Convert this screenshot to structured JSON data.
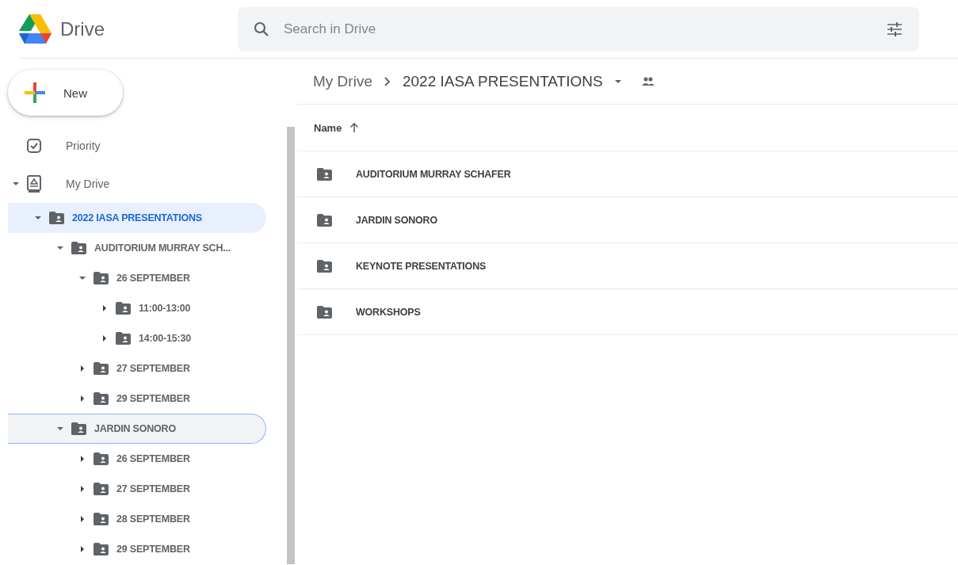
{
  "app": {
    "title": "Drive"
  },
  "search": {
    "placeholder": "Search in Drive"
  },
  "new_button": {
    "label": "New"
  },
  "sidebar": {
    "items": [
      {
        "label": "Priority",
        "kind": "priority",
        "selected": false,
        "focused": false
      },
      {
        "label": "My Drive",
        "kind": "drive",
        "expanded": true,
        "selected": false,
        "focused": false,
        "children": [
          {
            "label": "2022 IASA PRESENTATIONS",
            "kind": "folder",
            "expanded": true,
            "selected": true,
            "focused": false,
            "children": [
              {
                "label": "AUDITORIUM MURRAY SCH...",
                "kind": "folder",
                "expanded": true,
                "selected": false,
                "focused": false,
                "children": [
                  {
                    "label": "26 SEPTEMBER",
                    "kind": "folder",
                    "expanded": true,
                    "selected": false,
                    "focused": false,
                    "children": [
                      {
                        "label": "11:00-13:00",
                        "kind": "folder",
                        "expanded": false,
                        "selected": false,
                        "focused": false
                      },
                      {
                        "label": "14:00-15:30",
                        "kind": "folder",
                        "expanded": false,
                        "selected": false,
                        "focused": false
                      }
                    ]
                  },
                  {
                    "label": "27 SEPTEMBER",
                    "kind": "folder",
                    "expanded": false,
                    "selected": false,
                    "focused": false
                  },
                  {
                    "label": "29 SEPTEMBER",
                    "kind": "folder",
                    "expanded": false,
                    "selected": false,
                    "focused": false
                  }
                ]
              },
              {
                "label": "JARDIN SONORO",
                "kind": "folder",
                "expanded": true,
                "selected": false,
                "focused": true,
                "children": [
                  {
                    "label": "26 SEPTEMBER",
                    "kind": "folder",
                    "expanded": false,
                    "selected": false,
                    "focused": false
                  },
                  {
                    "label": "27 SEPTEMBER",
                    "kind": "folder",
                    "expanded": false,
                    "selected": false,
                    "focused": false
                  },
                  {
                    "label": "28 SEPTEMBER",
                    "kind": "folder",
                    "expanded": false,
                    "selected": false,
                    "focused": false
                  },
                  {
                    "label": "29 SEPTEMBER",
                    "kind": "folder",
                    "expanded": false,
                    "selected": false,
                    "focused": false
                  }
                ]
              }
            ]
          }
        ]
      }
    ]
  },
  "breadcrumb": [
    "My Drive",
    "2022 IASA PRESENTATIONS"
  ],
  "table": {
    "columns": [
      "Name"
    ],
    "rows": [
      {
        "name": "AUDITORIUM MURRAY SCHAFER"
      },
      {
        "name": "JARDIN SONORO"
      },
      {
        "name": "KEYNOTE PRESENTATIONS"
      },
      {
        "name": "WORKSHOPS"
      }
    ]
  }
}
